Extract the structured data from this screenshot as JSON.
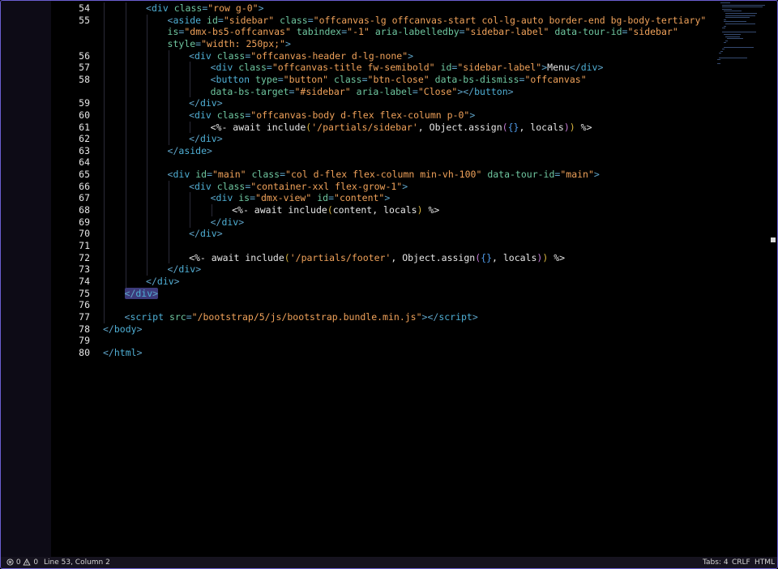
{
  "editor": {
    "lines": [
      {
        "n": "54",
        "indent": 4,
        "tokens": [
          [
            "p",
            "<"
          ],
          [
            "t",
            "div"
          ],
          [
            "s",
            " "
          ],
          [
            "a",
            "class"
          ],
          [
            "p",
            "="
          ],
          [
            "q",
            "\"row g-0\""
          ],
          [
            "p",
            ">"
          ]
        ]
      },
      {
        "n": "55",
        "indent": 5,
        "tokens": [
          [
            "p",
            "<"
          ],
          [
            "t",
            "aside"
          ],
          [
            "s",
            " "
          ],
          [
            "a",
            "id"
          ],
          [
            "p",
            "="
          ],
          [
            "q",
            "\"sidebar\""
          ],
          [
            "s",
            " "
          ],
          [
            "a",
            "class"
          ],
          [
            "p",
            "="
          ],
          [
            "q",
            "\"offcanvas-lg offcanvas-start col-lg-auto border-end bg-body-tertiary\""
          ]
        ]
      },
      {
        "n": "",
        "indent": 5,
        "tokens": [
          [
            "a",
            "is"
          ],
          [
            "p",
            "="
          ],
          [
            "q",
            "\"dmx-bs5-offcanvas\""
          ],
          [
            "s",
            " "
          ],
          [
            "a",
            "tabindex"
          ],
          [
            "p",
            "="
          ],
          [
            "q",
            "\"-1\""
          ],
          [
            "s",
            " "
          ],
          [
            "a",
            "aria-labelledby"
          ],
          [
            "p",
            "="
          ],
          [
            "q",
            "\"sidebar-label\""
          ],
          [
            "s",
            " "
          ],
          [
            "a",
            "data-tour-id"
          ],
          [
            "p",
            "="
          ],
          [
            "q",
            "\"sidebar\""
          ]
        ]
      },
      {
        "n": "",
        "indent": 5,
        "tokens": [
          [
            "a",
            "style"
          ],
          [
            "p",
            "="
          ],
          [
            "q",
            "\"width: 250px;\""
          ],
          [
            "p",
            ">"
          ]
        ]
      },
      {
        "n": "56",
        "indent": 6,
        "tokens": [
          [
            "p",
            "<"
          ],
          [
            "t",
            "div"
          ],
          [
            "s",
            " "
          ],
          [
            "a",
            "class"
          ],
          [
            "p",
            "="
          ],
          [
            "q",
            "\"offcanvas-header d-lg-none\""
          ],
          [
            "p",
            ">"
          ]
        ]
      },
      {
        "n": "57",
        "indent": 7,
        "tokens": [
          [
            "p",
            "<"
          ],
          [
            "t",
            "div"
          ],
          [
            "s",
            " "
          ],
          [
            "a",
            "class"
          ],
          [
            "p",
            "="
          ],
          [
            "q",
            "\"offcanvas-title fw-semibold\""
          ],
          [
            "s",
            " "
          ],
          [
            "a",
            "id"
          ],
          [
            "p",
            "="
          ],
          [
            "q",
            "\"sidebar-label\""
          ],
          [
            "p",
            ">"
          ],
          [
            "x",
            "Menu"
          ],
          [
            "p",
            "</"
          ],
          [
            "t",
            "div"
          ],
          [
            "p",
            ">"
          ]
        ]
      },
      {
        "n": "58",
        "indent": 7,
        "tokens": [
          [
            "p",
            "<"
          ],
          [
            "t",
            "button"
          ],
          [
            "s",
            " "
          ],
          [
            "a",
            "type"
          ],
          [
            "p",
            "="
          ],
          [
            "q",
            "\"button\""
          ],
          [
            "s",
            " "
          ],
          [
            "a",
            "class"
          ],
          [
            "p",
            "="
          ],
          [
            "q",
            "\"btn-close\""
          ],
          [
            "s",
            " "
          ],
          [
            "a",
            "data-bs-dismiss"
          ],
          [
            "p",
            "="
          ],
          [
            "q",
            "\"offcanvas\""
          ]
        ]
      },
      {
        "n": "",
        "indent": 7,
        "tokens": [
          [
            "a",
            "data-bs-target"
          ],
          [
            "p",
            "="
          ],
          [
            "q",
            "\"#sidebar\""
          ],
          [
            "s",
            " "
          ],
          [
            "a",
            "aria-label"
          ],
          [
            "p",
            "="
          ],
          [
            "q",
            "\"Close\""
          ],
          [
            "p",
            "></"
          ],
          [
            "t",
            "button"
          ],
          [
            "p",
            ">"
          ]
        ]
      },
      {
        "n": "59",
        "indent": 6,
        "tokens": [
          [
            "p",
            "</"
          ],
          [
            "t",
            "div"
          ],
          [
            "p",
            ">"
          ]
        ]
      },
      {
        "n": "60",
        "indent": 6,
        "tokens": [
          [
            "p",
            "<"
          ],
          [
            "t",
            "div"
          ],
          [
            "s",
            " "
          ],
          [
            "a",
            "class"
          ],
          [
            "p",
            "="
          ],
          [
            "q",
            "\"offcanvas-body d-flex flex-column p-0\""
          ],
          [
            "p",
            ">"
          ]
        ]
      },
      {
        "n": "61",
        "indent": 7,
        "tokens": [
          [
            "x",
            "<%- await include"
          ],
          [
            "b1",
            "("
          ],
          [
            "q",
            "'/partials/sidebar'"
          ],
          [
            "x",
            ", Object.assign"
          ],
          [
            "b2",
            "("
          ],
          [
            "b3",
            "{}"
          ],
          [
            "x",
            ", locals"
          ],
          [
            "b2",
            ")"
          ],
          [
            "b1",
            ")"
          ],
          [
            "x",
            " %>"
          ]
        ]
      },
      {
        "n": "62",
        "indent": 6,
        "tokens": [
          [
            "p",
            "</"
          ],
          [
            "t",
            "div"
          ],
          [
            "p",
            ">"
          ]
        ]
      },
      {
        "n": "63",
        "indent": 5,
        "tokens": [
          [
            "p",
            "</"
          ],
          [
            "t",
            "aside"
          ],
          [
            "p",
            ">"
          ]
        ]
      },
      {
        "n": "64",
        "indent": 0,
        "tokens": []
      },
      {
        "n": "65",
        "indent": 5,
        "tokens": [
          [
            "p",
            "<"
          ],
          [
            "t",
            "div"
          ],
          [
            "s",
            " "
          ],
          [
            "a",
            "id"
          ],
          [
            "p",
            "="
          ],
          [
            "q",
            "\"main\""
          ],
          [
            "s",
            " "
          ],
          [
            "a",
            "class"
          ],
          [
            "p",
            "="
          ],
          [
            "q",
            "\"col d-flex flex-column min-vh-100\""
          ],
          [
            "s",
            " "
          ],
          [
            "a",
            "data-tour-id"
          ],
          [
            "p",
            "="
          ],
          [
            "q",
            "\"main\""
          ],
          [
            "p",
            ">"
          ]
        ]
      },
      {
        "n": "66",
        "indent": 6,
        "tokens": [
          [
            "p",
            "<"
          ],
          [
            "t",
            "div"
          ],
          [
            "s",
            " "
          ],
          [
            "a",
            "class"
          ],
          [
            "p",
            "="
          ],
          [
            "q",
            "\"container-xxl flex-grow-1\""
          ],
          [
            "p",
            ">"
          ]
        ]
      },
      {
        "n": "67",
        "indent": 7,
        "tokens": [
          [
            "p",
            "<"
          ],
          [
            "t",
            "div"
          ],
          [
            "s",
            " "
          ],
          [
            "a",
            "is"
          ],
          [
            "p",
            "="
          ],
          [
            "q",
            "\"dmx-view\""
          ],
          [
            "s",
            " "
          ],
          [
            "a",
            "id"
          ],
          [
            "p",
            "="
          ],
          [
            "q",
            "\"content\""
          ],
          [
            "p",
            ">"
          ]
        ]
      },
      {
        "n": "68",
        "indent": 8,
        "tokens": [
          [
            "x",
            "<%- await include"
          ],
          [
            "b1",
            "("
          ],
          [
            "x",
            "content, locals"
          ],
          [
            "b1",
            ")"
          ],
          [
            "x",
            " %>"
          ]
        ]
      },
      {
        "n": "69",
        "indent": 7,
        "tokens": [
          [
            "p",
            "</"
          ],
          [
            "t",
            "div"
          ],
          [
            "p",
            ">"
          ]
        ]
      },
      {
        "n": "70",
        "indent": 6,
        "tokens": [
          [
            "p",
            "</"
          ],
          [
            "t",
            "div"
          ],
          [
            "p",
            ">"
          ]
        ]
      },
      {
        "n": "71",
        "indent": 0,
        "tokens": []
      },
      {
        "n": "72",
        "indent": 6,
        "tokens": [
          [
            "x",
            "<%- await include"
          ],
          [
            "b1",
            "("
          ],
          [
            "q",
            "'/partials/footer'"
          ],
          [
            "x",
            ", Object.assign"
          ],
          [
            "b2",
            "("
          ],
          [
            "b3",
            "{}"
          ],
          [
            "x",
            ", locals"
          ],
          [
            "b2",
            ")"
          ],
          [
            "b1",
            ")"
          ],
          [
            "x",
            " %>"
          ]
        ]
      },
      {
        "n": "73",
        "indent": 5,
        "tokens": [
          [
            "p",
            "</"
          ],
          [
            "t",
            "div"
          ],
          [
            "p",
            ">"
          ]
        ]
      },
      {
        "n": "74",
        "indent": 4,
        "tokens": [
          [
            "p",
            "</"
          ],
          [
            "t",
            "div"
          ],
          [
            "p",
            ">"
          ]
        ]
      },
      {
        "n": "75",
        "indent": 3,
        "highlight": true,
        "tokens": [
          [
            "p",
            "</"
          ],
          [
            "t",
            "div"
          ],
          [
            "p",
            ">"
          ]
        ]
      },
      {
        "n": "76",
        "indent": 0,
        "tokens": []
      },
      {
        "n": "77",
        "indent": 3,
        "tokens": [
          [
            "p",
            "<"
          ],
          [
            "t",
            "script"
          ],
          [
            "s",
            " "
          ],
          [
            "a",
            "src"
          ],
          [
            "p",
            "="
          ],
          [
            "q",
            "\"/bootstrap/5/js/bootstrap.bundle.min.js\""
          ],
          [
            "p",
            "></"
          ],
          [
            "t",
            "script"
          ],
          [
            "p",
            ">"
          ]
        ]
      },
      {
        "n": "78",
        "indent": 2,
        "tokens": [
          [
            "p",
            "</"
          ],
          [
            "t",
            "body"
          ],
          [
            "p",
            ">"
          ]
        ]
      },
      {
        "n": "79",
        "indent": 0,
        "tokens": []
      },
      {
        "n": "80",
        "indent": 2,
        "tokens": [
          [
            "p",
            "</"
          ],
          [
            "t",
            "html"
          ],
          [
            "p",
            ">"
          ]
        ]
      }
    ]
  },
  "status": {
    "errors": "0",
    "warnings": "0",
    "cursor": "Line 53, Column 2",
    "tabs": "Tabs: 4",
    "eol": "CRLF",
    "language": "HTML"
  },
  "colors": {
    "accent_border": "#6b5fd1",
    "background": "#000000",
    "tag": "#4fb0d6",
    "attribute": "#6fc7a0",
    "string": "#f0a25a"
  }
}
